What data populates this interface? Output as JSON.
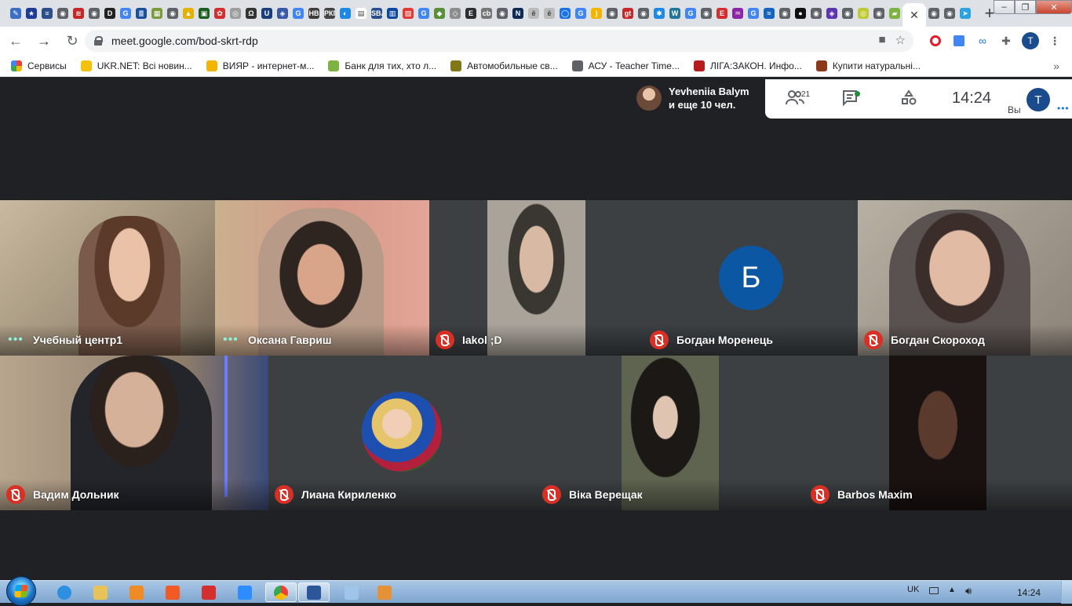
{
  "browser": {
    "url": "meet.google.com/bod-skrt-rdp",
    "new_tab_symbol": "+",
    "close_tab_symbol": "✕",
    "profile_initial": "T",
    "favicons": [
      {
        "color": "#3b6fc4",
        "glyph": "✎"
      },
      {
        "color": "#1e3c96",
        "glyph": "★"
      },
      {
        "color": "#2c4f8c",
        "glyph": "≡"
      },
      {
        "color": "#5f6368",
        "glyph": "◉"
      },
      {
        "color": "#c62828",
        "glyph": "≋"
      },
      {
        "color": "#5f6368",
        "glyph": "◉"
      },
      {
        "color": "#222222",
        "glyph": "D"
      },
      {
        "color": "#4285f4",
        "glyph": "G"
      },
      {
        "color": "#1a4fa0",
        "glyph": "≣"
      },
      {
        "color": "#7b9a3c",
        "glyph": "▦"
      },
      {
        "color": "#5f6368",
        "glyph": "◉"
      },
      {
        "color": "#e3b100",
        "glyph": "▲"
      },
      {
        "color": "#1b5e20",
        "glyph": "▣"
      },
      {
        "color": "#d32f2f",
        "glyph": "✿"
      },
      {
        "color": "#9e9e9e",
        "glyph": "◎"
      },
      {
        "color": "#333333",
        "glyph": "Ω"
      },
      {
        "color": "#1a3d7c",
        "glyph": "U"
      },
      {
        "color": "#3a5aa8",
        "glyph": "◈"
      },
      {
        "color": "#4285f4",
        "glyph": "G"
      },
      {
        "color": "#3d3d3d",
        "glyph": "НВ"
      },
      {
        "color": "#444444",
        "glyph": "РКГ"
      },
      {
        "color": "#1e88e5",
        "glyph": "◐"
      },
      {
        "color": "#ffffff",
        "glyph": "▤"
      },
      {
        "color": "#2a4d8f",
        "glyph": "SBA"
      },
      {
        "color": "#0d47a1",
        "glyph": "▥"
      },
      {
        "color": "#e53935",
        "glyph": "▧"
      },
      {
        "color": "#4285f4",
        "glyph": "G"
      },
      {
        "color": "#5a8f3a",
        "glyph": "◆"
      },
      {
        "color": "#8d8d8d",
        "glyph": "◇"
      },
      {
        "color": "#2e2e2e",
        "glyph": "E"
      },
      {
        "color": "#777777",
        "glyph": "cb"
      },
      {
        "color": "#5f6368",
        "glyph": "◉"
      },
      {
        "color": "#0d2a57",
        "glyph": "N"
      },
      {
        "color": "#bbbbbb",
        "glyph": "ё"
      },
      {
        "color": "#bbbbbb",
        "glyph": "ё"
      },
      {
        "color": "#1a73e8",
        "glyph": "◯"
      },
      {
        "color": "#4285f4",
        "glyph": "G"
      },
      {
        "color": "#f4b400",
        "glyph": ")"
      },
      {
        "color": "#5f6368",
        "glyph": "◉"
      },
      {
        "color": "#c62828",
        "glyph": "gt"
      },
      {
        "color": "#5f6368",
        "glyph": "◉"
      },
      {
        "color": "#1e88e5",
        "glyph": "✱"
      },
      {
        "color": "#21759b",
        "glyph": "W"
      },
      {
        "color": "#4285f4",
        "glyph": "G"
      },
      {
        "color": "#5f6368",
        "glyph": "◉"
      },
      {
        "color": "#d32f2f",
        "glyph": "E"
      },
      {
        "color": "#8e24aa",
        "glyph": "♒"
      },
      {
        "color": "#4285f4",
        "glyph": "G"
      },
      {
        "color": "#1565c0",
        "glyph": "≈"
      },
      {
        "color": "#5f6368",
        "glyph": "◉"
      },
      {
        "color": "#111111",
        "glyph": "●"
      },
      {
        "color": "#5f6368",
        "glyph": "◉"
      },
      {
        "color": "#5e35b1",
        "glyph": "◈"
      },
      {
        "color": "#5f6368",
        "glyph": "◉"
      },
      {
        "color": "#c0ca33",
        "glyph": "◎"
      },
      {
        "color": "#5f6368",
        "glyph": "◉"
      },
      {
        "color": "#7cb342",
        "glyph": "▰"
      }
    ],
    "favicons_after": [
      {
        "color": "#5f6368",
        "glyph": "◉"
      },
      {
        "color": "#5f6368",
        "glyph": "◉"
      },
      {
        "color": "#2aa3e0",
        "glyph": "➤"
      }
    ]
  },
  "bookmarks": [
    {
      "label": "Сервисы",
      "color": "#5f6368"
    },
    {
      "label": "UKR.NET: Всі новин...",
      "color": "#f4c20d"
    },
    {
      "label": "ВИЯР - интернет-м...",
      "color": "#f4b400"
    },
    {
      "label": "Банк для тих, хто л...",
      "color": "#7cb342"
    },
    {
      "label": "Автомобильные св...",
      "color": "#827717"
    },
    {
      "label": "АСУ - Teacher Time...",
      "color": "#5f6368"
    },
    {
      "label": "ЛІГА:ЗАКОН. Инфо...",
      "color": "#b71c1c"
    },
    {
      "label": "Купити натуральні...",
      "color": "#8d3a1a"
    }
  ],
  "bookmarks_more": "»",
  "meet": {
    "presenter_name": "Yevheniia Balym",
    "presenter_others": "и еще 10 чел.",
    "people_count": "21",
    "clock": "14:24",
    "you_label": "Вы",
    "you_initial": "T",
    "you_dots": "•••",
    "talk_dots": "•••",
    "letter_avatar": "Б",
    "participants": [
      {
        "name": "Учебный центр1",
        "muted": false
      },
      {
        "name": "Оксана Гавриш",
        "muted": false
      },
      {
        "name": "Iakol ;D",
        "muted": true
      },
      {
        "name": "Богдан Моренець",
        "muted": true
      },
      {
        "name": "Богдан Скороход",
        "muted": true
      },
      {
        "name": "Вадим Дольник",
        "muted": true
      },
      {
        "name": "Лиана Кириленко",
        "muted": true
      },
      {
        "name": "Віка Верещак",
        "muted": true
      },
      {
        "name": "Barbos Maxim",
        "muted": true
      }
    ]
  },
  "taskbar": {
    "language": "UK",
    "time": "14:24",
    "apps": [
      {
        "name": "internet-explorer",
        "color": "#2d8fe0"
      },
      {
        "name": "file-explorer",
        "color": "#e8c35a"
      },
      {
        "name": "media-player",
        "color": "#f08a24"
      },
      {
        "name": "brave",
        "color": "#f15a24"
      },
      {
        "name": "acrobat-reader",
        "color": "#d32f2f"
      },
      {
        "name": "zoom",
        "color": "#2d8cff"
      },
      {
        "name": "chrome",
        "color": "#34a853"
      },
      {
        "name": "word",
        "color": "#2b579a"
      },
      {
        "name": "notepad",
        "color": "#9fc5e8"
      },
      {
        "name": "paint",
        "color": "#e69138"
      }
    ]
  }
}
